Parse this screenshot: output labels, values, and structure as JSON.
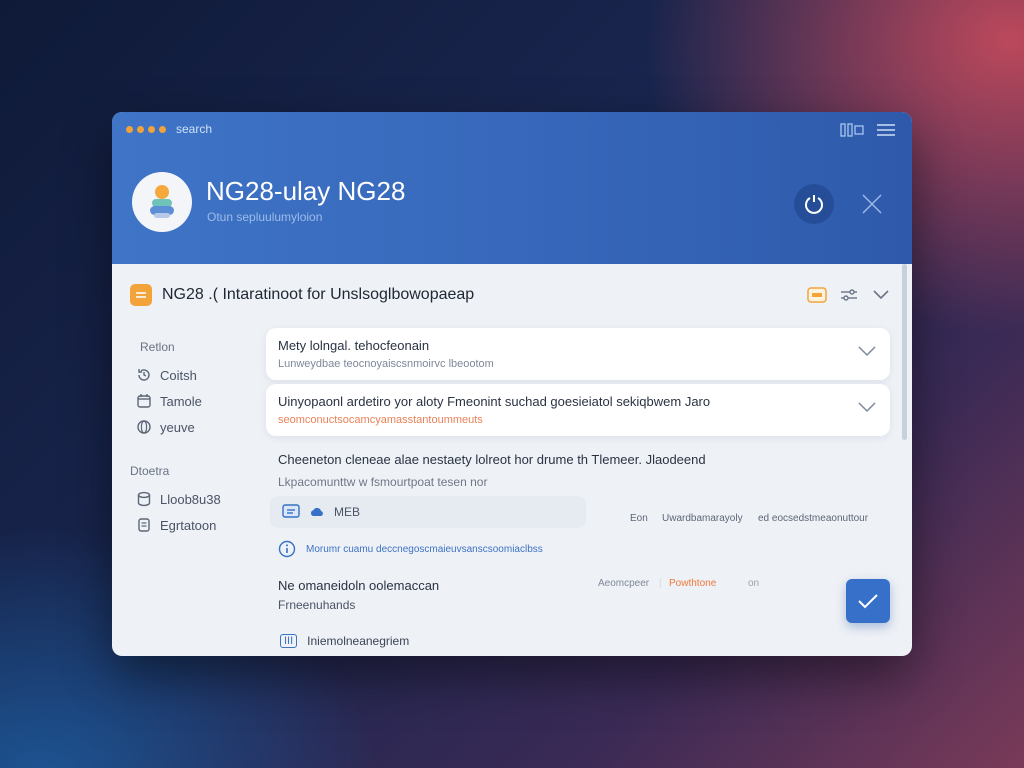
{
  "window": {
    "titlebar_text": "search"
  },
  "header": {
    "title": "NG28-ulay NG28",
    "subtitle": "Otun sepluulumyloion"
  },
  "section": {
    "title": "NG28 .( Intaratinoot for Unslsoglbowopaeap"
  },
  "sidebar": {
    "group1": {
      "heading": "Retlon",
      "items": [
        {
          "label": "Coitsh",
          "icon": "history-icon"
        },
        {
          "label": "Tamole",
          "icon": "calendar-icon"
        },
        {
          "label": "yeuve",
          "icon": "globe-icon"
        }
      ]
    },
    "group2": {
      "heading": "Dtoetra",
      "items": [
        {
          "label": "Lloob8u38",
          "icon": "database-icon"
        },
        {
          "label": "Egrtatoon",
          "icon": "document-icon"
        }
      ]
    }
  },
  "cards": [
    {
      "title": "Mety lolngal. tehocfeonain",
      "subtitle": "Lunweydbae teocnoyaiscsnmoirvc lbeootom"
    },
    {
      "title": "Uinyopaonl ardetiro yor aloty Fmeonint suchad goesieiatol sekiqbwem Jaro",
      "subtitle": "seomconuctsocamcyamasstantoummeuts"
    }
  ],
  "block": {
    "title": "Cheeneton cleneae alae nestaety lolreot hor drume th Tlemeer. Jlaodeend",
    "subtitle": "Lkpacomunttw w fsmourtpoat tesen nor"
  },
  "select": {
    "value": "MEB"
  },
  "meta": {
    "left": "Eon",
    "middle": "Uwardbamarayoly",
    "right": "ed eocsedstmeaonuttour"
  },
  "info": {
    "text": "Morumr cuamu deccnegoscmaieuvsanscsoomiaclbss"
  },
  "status": {
    "title": "Ne omaneidoln oolemaccan",
    "subtitle": "Frneenuhands",
    "label1": "Aeomcpeer",
    "label2": "Powthtone",
    "label3": "on"
  },
  "footer": {
    "tag": "III",
    "text": "Iniemolneanegriem"
  },
  "colors": {
    "accent": "#3670c8",
    "header_blue": "#3768bb",
    "badge_orange": "#f2a43b",
    "warning_orange": "#f07a3a"
  }
}
